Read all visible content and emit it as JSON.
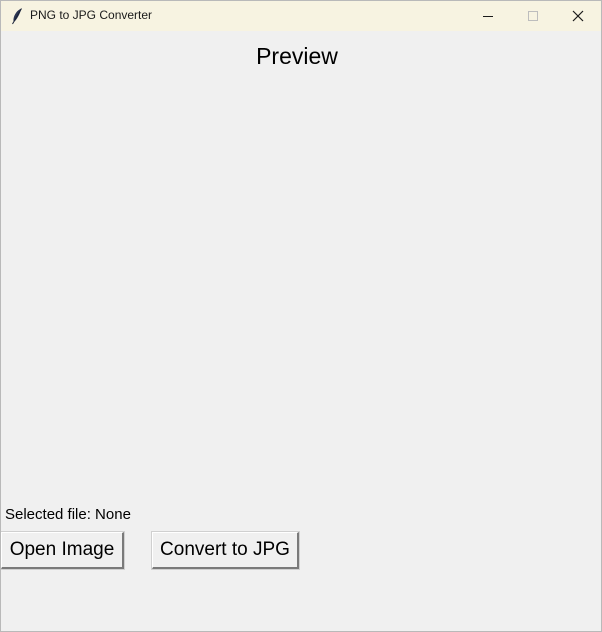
{
  "window": {
    "title": "PNG to JPG Converter",
    "app_icon": "feather-icon",
    "controls": {
      "minimize_icon": "minimize-icon",
      "maximize_icon": "maximize-icon",
      "close_icon": "close-icon"
    }
  },
  "main": {
    "preview_title": "Preview",
    "selected_file_text": "Selected file: None",
    "open_button_label": "Open Image",
    "convert_button_label": "Convert to JPG"
  },
  "colors": {
    "titlebar_bg": "#f7f3e1",
    "window_bg": "#f0f0f0"
  }
}
